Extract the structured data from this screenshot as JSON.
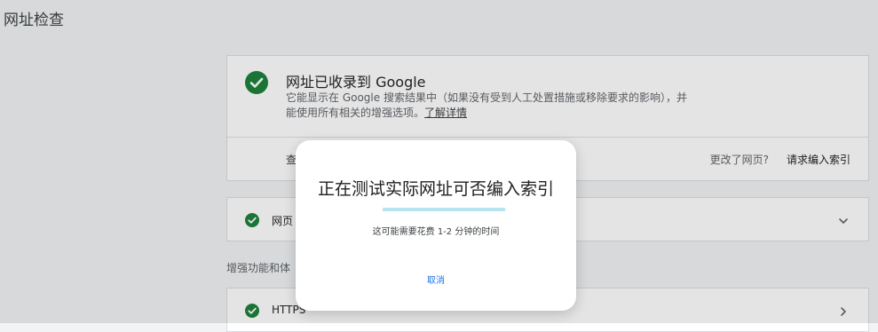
{
  "page": {
    "title": "网址检查"
  },
  "index_status": {
    "title": "网址已收录到 Google",
    "description": "它能显示在 Google 搜索结果中（如果没有受到人工处置措施或移除要求的影响），并能使用所有相关的增强选项。",
    "learn_more": "了解详情",
    "action_truncated": "查",
    "changed_question": "更改了网页?",
    "request_indexing": "请求编入索引",
    "icon": "check-circle-icon",
    "color": "#188038"
  },
  "page_row": {
    "label": "网页"
  },
  "section": {
    "label": "增强功能和体"
  },
  "https_row": {
    "label": "HTTPS"
  },
  "dialog": {
    "title": "正在测试实际网址可否编入索引",
    "subtitle": "这可能需要花费 1-2 分钟的时间",
    "cancel": "取消",
    "progress": 0
  },
  "colors": {
    "accent": "#1a73e8",
    "success": "#188038"
  }
}
